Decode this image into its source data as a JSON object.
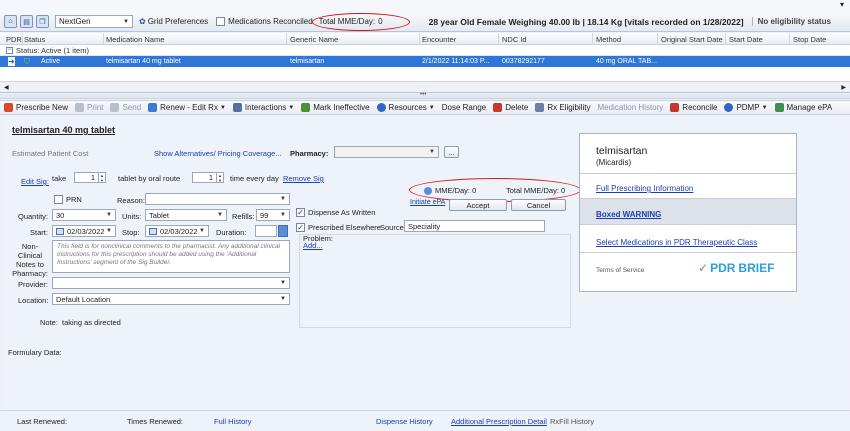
{
  "toolbar": {
    "provider": "NextGen",
    "grid_preferences": "Grid Preferences",
    "meds_reconciled": "Medications Reconciled",
    "total_mme_label": "Total MME/Day:",
    "total_mme_value": "0",
    "patient_info": "28 year Old Female Weighing 40.00 lb  | 18.14 Kg [vitals recorded on 1/28/2022]",
    "eligibility": "No eligibility status"
  },
  "grid": {
    "columns": [
      "PDR",
      "Status",
      "Medication Name",
      "Generic Name",
      "Encounter",
      "NDC Id",
      "Method",
      "Original Start Date",
      "Start Date",
      "Stop Date"
    ],
    "status_group": "Status:  Active (1 item)",
    "row": {
      "status": "Active",
      "medication": "telmisartan 40 mg tablet",
      "generic": "telmisartan",
      "encounter": "2/1/2022 11:14:03 P...",
      "ndc": "00378292177",
      "method": "40 mg ORAL TAB..."
    }
  },
  "actions": {
    "prescribe_new": "Prescribe New",
    "print": "Print",
    "send": "Send",
    "renew": "Renew - Edit Rx",
    "interactions": "Interactions",
    "mark_ineffective": "Mark Ineffective",
    "resources": "Resources",
    "dose_range": "Dose Range",
    "delete": "Delete",
    "rx_eligibility": "Rx Eligibility",
    "medication_history": "Medication History",
    "reconcile": "Reconcile",
    "pdmp": "PDMP",
    "manage_epa": "Manage ePA"
  },
  "form": {
    "title": "telmisartan 40 mg tablet",
    "estimated_cost": "Estimated Patient Cost",
    "show_alternatives": "Show Alternatives/ Pricing Coverage...",
    "pharmacy_label": "Pharmacy:",
    "ellipsis": "...",
    "edit_sig": "Edit Sig:",
    "take": "take",
    "take_qty": "1",
    "tablet_route": "tablet by oral route",
    "freq_qty": "1",
    "time_every_day": "time every day",
    "remove_sig": "Remove Sig",
    "prn": "PRN",
    "reason_label": "Reason:",
    "quantity_label": "Quantity:",
    "quantity_value": "30",
    "units_label": "Units:",
    "units_value": "Tablet",
    "refills_label": "Refills:",
    "refills_value": "99",
    "start_label": "Start:",
    "start_value": "02/03/2022",
    "stop_label": "Stop:",
    "stop_value": "02/03/2022",
    "duration_label": "Duration:",
    "notes_label": "Non-Clinical Notes to Pharmacy:",
    "notes_placeholder": "This field is for nonclinical comments to the pharmacist. Any additional clinical instructions for this prescription should be added using the 'Additional Instructions' segment of the Sig Builder.",
    "provider_label": "Provider:",
    "location_label": "Location:",
    "location_value": "Default Location",
    "note_label": "Note:",
    "note_value": "taking as directed",
    "formulary_label": "Formulary Data:",
    "mme_day": "MME/Day: 0",
    "total_mme_day": "Total MME/Day: 0",
    "initiate_epa": "Initiate ePA",
    "accept": "Accept",
    "cancel": "Cancel",
    "dispense_as_written": "Dispense As Written",
    "prescribed_elsewhere": "Prescribed Elsewhere",
    "source_label": "Source:",
    "source_value": "Speciality",
    "problem_label": "Problem:",
    "add": "Add..."
  },
  "pdr": {
    "drug": "telmisartan",
    "brand": "(Micardis)",
    "full_info": "Full Prescribing Information",
    "boxed_warning": "Boxed WARNING",
    "select_meds": "Select Medications in PDR Therapeutic Class",
    "terms": "Terms of Service",
    "logo_text": "PDR",
    "logo_brief": "BRIEF"
  },
  "bottom": {
    "last_renewed": "Last Renewed:",
    "times_renewed": "Times Renewed:",
    "full_history": "Full History",
    "dispense_history": "Dispense History",
    "additional_detail": "Additional Prescription Detail",
    "rxfill_history": "RxFill History"
  },
  "colors": {
    "selection": "#2e76d8",
    "highlight_oval": "#d21b1b",
    "link": "#1a3fb0",
    "pdr_green": "#4caf50"
  }
}
